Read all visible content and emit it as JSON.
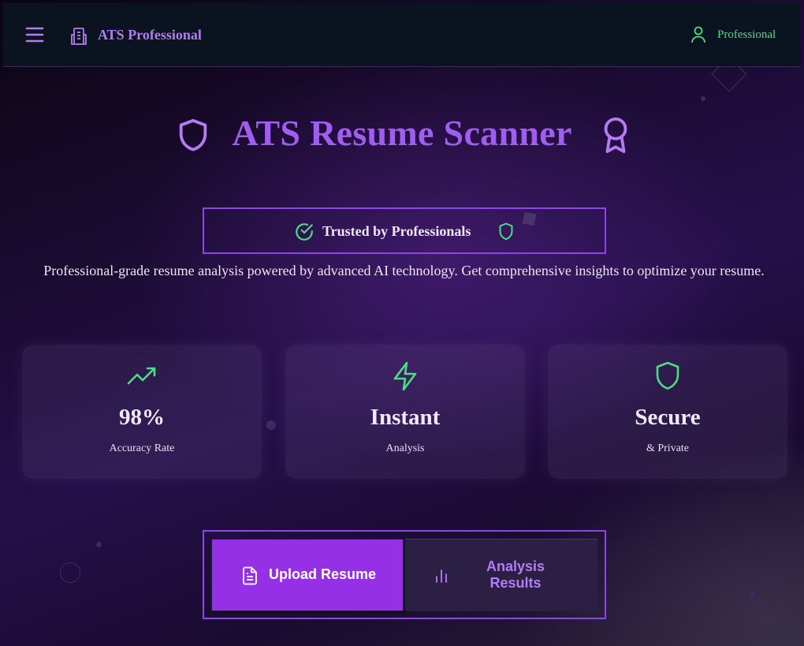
{
  "nav": {
    "brand": "ATS Professional",
    "user_label": "Professional",
    "icons": {
      "menu": "hamburger-icon",
      "brand": "building-icon",
      "user": "user-icon"
    }
  },
  "hero": {
    "title": "ATS Resume Scanner",
    "icons": {
      "left": "shield-icon",
      "right": "award-icon"
    }
  },
  "badge": {
    "text": "Trusted by Professionals",
    "icons": {
      "left": "check-circle-icon",
      "right": "shield-icon"
    }
  },
  "description": "Professional-grade resume analysis powered by advanced AI technology. Get comprehensive insights to optimize your resume.",
  "stats": [
    {
      "value": "98%",
      "label": "Accuracy Rate",
      "icon": "trending-up-icon"
    },
    {
      "value": "Instant",
      "label": "Analysis",
      "icon": "zap-icon"
    },
    {
      "value": "Secure",
      "label": "& Private",
      "icon": "shield-icon"
    }
  ],
  "tabs": {
    "upload": {
      "label": "Upload Resume",
      "icon": "file-text-icon",
      "active": true
    },
    "results": {
      "label": "Analysis Results",
      "icon": "bar-chart-icon",
      "active": false
    }
  },
  "colors": {
    "accent": "#a05ef0",
    "button": "#9530e6",
    "success": "#4ade80",
    "nav_bg": "#0b1320"
  }
}
